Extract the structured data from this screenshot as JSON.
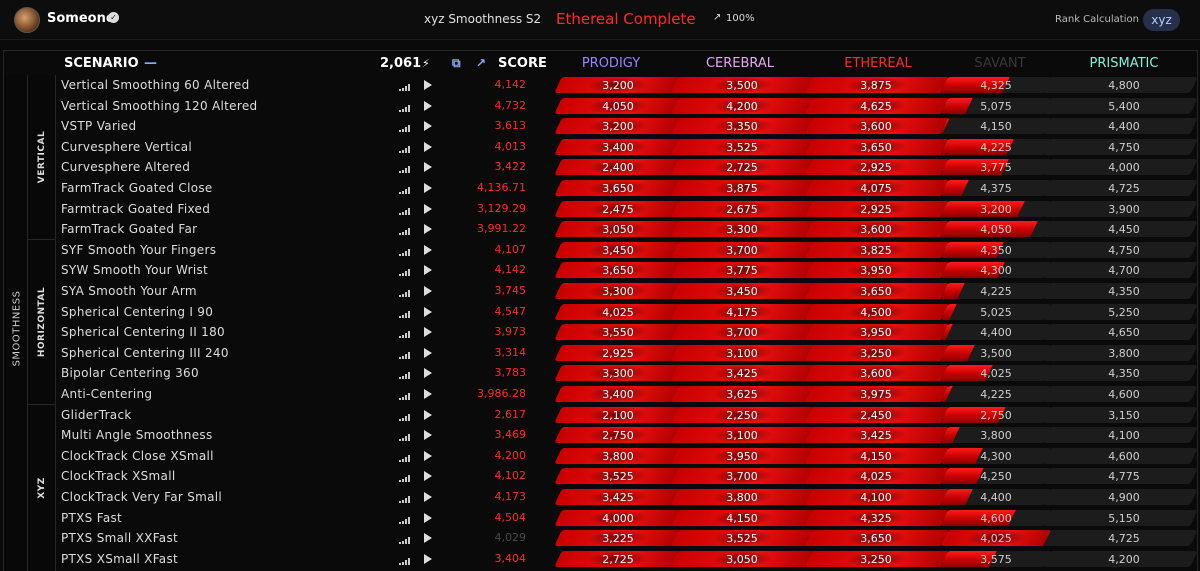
{
  "user": {
    "name": "Someone"
  },
  "benchmark": {
    "name": "xyz Smoothness S2",
    "rank_label": "Ethereal Complete",
    "progress": "100%"
  },
  "rank_calc": {
    "label": "Rank Calculation",
    "value": "xyz"
  },
  "header": {
    "scenario": "SCENARIO",
    "collapse": "—",
    "total": "2,061",
    "score": "SCORE"
  },
  "ranks": [
    {
      "name": "PRODIGY",
      "color": "#9a86ff"
    },
    {
      "name": "CEREBRAL",
      "color": "#e8a6f6"
    },
    {
      "name": "ETHEREAL",
      "color": "#ff2a2a"
    },
    {
      "name": "SAVANT",
      "color": "#383838"
    },
    {
      "name": "PRISMATIC",
      "color": "#86f0d4"
    }
  ],
  "category": "SMOOTHNESS",
  "subcategories": [
    {
      "name": "VERTICAL",
      "rows": 8
    },
    {
      "name": "HORIZONTAL",
      "rows": 8
    },
    {
      "name": "XYZ",
      "rows": 8
    }
  ],
  "scenarios": [
    {
      "name": "Vertical Smoothing 60 Altered",
      "score": "4,142",
      "v": 4142,
      "t": [
        "3,200",
        "3,500",
        "3,875",
        "4,325",
        "4,800"
      ]
    },
    {
      "name": "Vertical Smoothing 120 Altered",
      "score": "4,732",
      "v": 4732,
      "t": [
        "4,050",
        "4,200",
        "4,625",
        "5,075",
        "5,400"
      ]
    },
    {
      "name": "VSTP Varied",
      "score": "3,613",
      "v": 3613,
      "t": [
        "3,200",
        "3,350",
        "3,600",
        "4,150",
        "4,400"
      ]
    },
    {
      "name": "Curvesphere Vertical",
      "score": "4,013",
      "v": 4013,
      "t": [
        "3,400",
        "3,525",
        "3,650",
        "4,225",
        "4,750"
      ]
    },
    {
      "name": "Curvesphere Altered",
      "score": "3,422",
      "v": 3422,
      "t": [
        "2,400",
        "2,725",
        "2,925",
        "3,775",
        "4,000"
      ]
    },
    {
      "name": "FarmTrack Goated Close",
      "score": "4,136.71",
      "v": 4136.71,
      "t": [
        "3,650",
        "3,875",
        "4,075",
        "4,375",
        "4,725"
      ]
    },
    {
      "name": "Farmtrack Goated Fixed",
      "score": "3,129.29",
      "v": 3129.29,
      "t": [
        "2,475",
        "2,675",
        "2,925",
        "3,200",
        "3,900"
      ]
    },
    {
      "name": "FarmTrack Goated Far",
      "score": "3,991.22",
      "v": 3991.22,
      "t": [
        "3,050",
        "3,300",
        "3,600",
        "4,050",
        "4,450"
      ]
    },
    {
      "name": "SYF Smooth Your Fingers",
      "score": "4,107",
      "v": 4107,
      "t": [
        "3,450",
        "3,700",
        "3,825",
        "4,350",
        "4,750"
      ]
    },
    {
      "name": "SYW Smooth Your Wrist",
      "score": "4,142",
      "v": 4142,
      "t": [
        "3,650",
        "3,775",
        "3,950",
        "4,300",
        "4,700"
      ]
    },
    {
      "name": "SYA Smooth Your Arm",
      "score": "3,745",
      "v": 3745,
      "t": [
        "3,300",
        "3,450",
        "3,650",
        "4,225",
        "4,350"
      ]
    },
    {
      "name": "Spherical Centering I 90",
      "score": "4,547",
      "v": 4547,
      "t": [
        "4,025",
        "4,175",
        "4,500",
        "5,025",
        "5,250"
      ]
    },
    {
      "name": "Spherical Centering II 180",
      "score": "3,973",
      "v": 3973,
      "t": [
        "3,550",
        "3,700",
        "3,950",
        "4,400",
        "4,650"
      ]
    },
    {
      "name": "Spherical Centering III 240",
      "score": "3,314",
      "v": 3314,
      "t": [
        "2,925",
        "3,100",
        "3,250",
        "3,500",
        "3,800"
      ]
    },
    {
      "name": "Bipolar Centering 360",
      "score": "3,783",
      "v": 3783,
      "t": [
        "3,300",
        "3,425",
        "3,600",
        "4,025",
        "4,350"
      ]
    },
    {
      "name": "Anti-Centering",
      "score": "3,986.28",
      "v": 3986.28,
      "t": [
        "3,400",
        "3,625",
        "3,975",
        "4,225",
        "4,600"
      ]
    },
    {
      "name": "GliderTrack",
      "score": "2,617",
      "v": 2617,
      "t": [
        "2,100",
        "2,250",
        "2,450",
        "2,750",
        "3,150"
      ]
    },
    {
      "name": "Multi Angle Smoothness",
      "score": "3,469",
      "v": 3469,
      "t": [
        "2,750",
        "3,100",
        "3,425",
        "3,800",
        "4,100"
      ]
    },
    {
      "name": "ClockTrack Close XSmall",
      "score": "4,200",
      "v": 4200,
      "t": [
        "3,800",
        "3,950",
        "4,150",
        "4,300",
        "4,600"
      ]
    },
    {
      "name": "ClockTrack XSmall",
      "score": "4,102",
      "v": 4102,
      "t": [
        "3,525",
        "3,700",
        "4,025",
        "4,250",
        "4,775"
      ]
    },
    {
      "name": "ClockTrack Very Far Small",
      "score": "4,173",
      "v": 4173,
      "t": [
        "3,425",
        "3,800",
        "4,100",
        "4,400",
        "4,900"
      ]
    },
    {
      "name": "PTXS Fast",
      "score": "4,504",
      "v": 4504,
      "t": [
        "4,000",
        "4,150",
        "4,325",
        "4,600",
        "5,150"
      ]
    },
    {
      "name": "PTXS Small XXFast",
      "score": "4,029",
      "v": 4029,
      "dim": true,
      "t": [
        "3,225",
        "3,525",
        "3,650",
        "4,025",
        "4,725"
      ]
    },
    {
      "name": "PTXS XSmall XFast",
      "score": "3,404",
      "v": 3404,
      "t": [
        "2,725",
        "3,050",
        "3,250",
        "3,575",
        "4,200"
      ]
    }
  ]
}
